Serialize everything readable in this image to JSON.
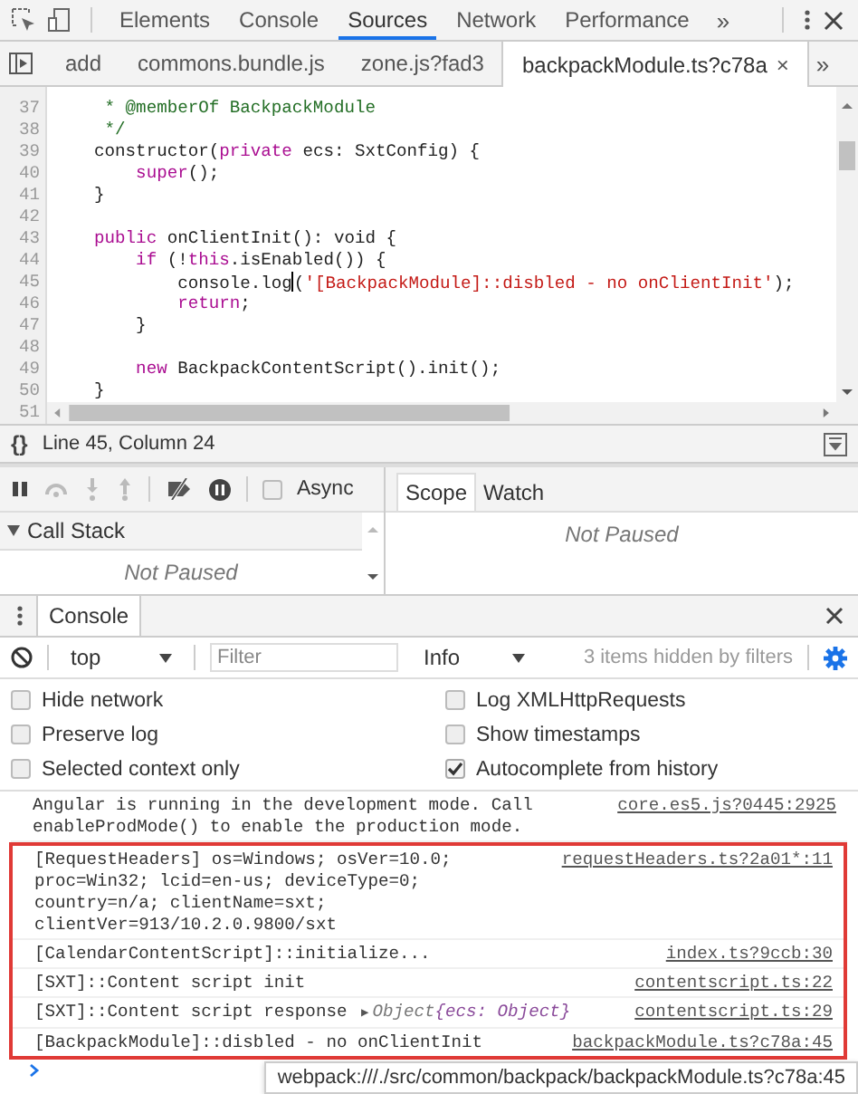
{
  "top_tabs": [
    {
      "label": "Elements",
      "selected": false
    },
    {
      "label": "Console",
      "selected": false
    },
    {
      "label": "Sources",
      "selected": true
    },
    {
      "label": "Network",
      "selected": false
    },
    {
      "label": "Performance",
      "selected": false
    }
  ],
  "top_more": "»",
  "file_tabs": [
    {
      "label": "add",
      "selected": false
    },
    {
      "label": "commons.bundle.js",
      "selected": false
    },
    {
      "label": "zone.js?fad3",
      "selected": false
    },
    {
      "label": "backpackModule.ts?c78a",
      "selected": true,
      "close": "×"
    }
  ],
  "file_more": "»",
  "editor": {
    "lines": [
      {
        "number": "37",
        "tokens": [
          {
            "kind": "comment",
            "text": "     * @memberOf BackpackModule"
          }
        ]
      },
      {
        "number": "38",
        "tokens": [
          {
            "kind": "comment",
            "text": "     */"
          }
        ]
      },
      {
        "number": "39",
        "tokens": [
          {
            "kind": "plain",
            "text": "    constructor("
          },
          {
            "kind": "keyword",
            "text": "private"
          },
          {
            "kind": "plain",
            "text": " ecs: SxtConfig) {"
          }
        ]
      },
      {
        "number": "40",
        "tokens": [
          {
            "kind": "keyword",
            "text": "        super"
          },
          {
            "kind": "plain",
            "text": "();"
          }
        ]
      },
      {
        "number": "41",
        "tokens": [
          {
            "kind": "plain",
            "text": "    }"
          }
        ]
      },
      {
        "number": "42"
      },
      {
        "number": "43",
        "tokens": [
          {
            "kind": "keyword",
            "text": "    public"
          },
          {
            "kind": "plain",
            "text": " onClientInit(): void {"
          }
        ]
      },
      {
        "number": "44",
        "tokens": [
          {
            "kind": "keyword",
            "text": "        if"
          },
          {
            "kind": "plain",
            "text": " (!"
          },
          {
            "kind": "keyword",
            "text": "this"
          },
          {
            "kind": "plain",
            "text": ".isEnabled()) {"
          }
        ]
      },
      {
        "number": "45",
        "tokens": [
          {
            "kind": "plain",
            "text": "            console.log"
          },
          {
            "kind": "cursor"
          },
          {
            "kind": "plain",
            "text": "("
          },
          {
            "kind": "string",
            "text": "'[BackpackModule]::disbled - no onClientInit'"
          },
          {
            "kind": "plain",
            "text": ");"
          }
        ]
      },
      {
        "number": "46",
        "tokens": [
          {
            "kind": "keyword",
            "text": "            return"
          },
          {
            "kind": "plain",
            "text": ";"
          }
        ]
      },
      {
        "number": "47",
        "tokens": [
          {
            "kind": "plain",
            "text": "        }"
          }
        ]
      },
      {
        "number": "48"
      },
      {
        "number": "49",
        "tokens": [
          {
            "kind": "keyword",
            "text": "        new"
          },
          {
            "kind": "plain",
            "text": " BackpackContentScript().init();"
          }
        ]
      },
      {
        "number": "50",
        "tokens": [
          {
            "kind": "plain",
            "text": "    }"
          }
        ]
      }
    ],
    "last_number": "51"
  },
  "status": {
    "format": "{}",
    "position": "Line 45, Column 24"
  },
  "debugger": {
    "async": {
      "label": "Async",
      "checked": false
    },
    "sidebar_tabs": [
      {
        "label": "Scope",
        "selected": true
      },
      {
        "label": "Watch",
        "selected": false
      }
    ],
    "call_stack": {
      "title": "Call Stack",
      "empty_text": "Not Paused"
    },
    "scope_text": "Not Paused"
  },
  "drawer_tabs": [
    {
      "label": "Console",
      "selected": true
    }
  ],
  "console_toolbar": {
    "context": "top",
    "filter_placeholder": "Filter",
    "level": "Info",
    "hidden_note": "3 items hidden by filters"
  },
  "settings": [
    {
      "label": "Hide network",
      "checked": false
    },
    {
      "label": "Log XMLHttpRequests",
      "checked": false
    },
    {
      "label": "Preserve log",
      "checked": false
    },
    {
      "label": "Show timestamps",
      "checked": false
    },
    {
      "label": "Selected context only",
      "checked": false
    },
    {
      "label": "Autocomplete from history",
      "checked": true
    }
  ],
  "messages": [
    {
      "text": "Angular is running in the development mode. Call enableProdMode() to enable the production mode.",
      "source": "core.es5.js?0445:2925",
      "highlighted": false
    },
    {
      "text": "[RequestHeaders] os=Windows; osVer=10.0; proc=Win32; lcid=en-us; deviceType=0; country=n/a; clientName=sxt; clientVer=913/10.2.0.9800/sxt",
      "source": "requestHeaders.ts?2a01*:11",
      "highlighted": true
    },
    {
      "text": "[CalendarContentScript]::initialize...",
      "source": "index.ts?9ccb:30",
      "highlighted": true
    },
    {
      "text": "[SXT]::Content script init",
      "source": "contentscript.ts:22",
      "highlighted": true
    },
    {
      "text": "[SXT]::Content script response ",
      "object": {
        "arrow": "▶",
        "label": "Object",
        "preview": "{ecs: Object}"
      },
      "source": "contentscript.ts:29",
      "highlighted": true
    },
    {
      "text": "[BackpackModule]::disbled - no onClientInit",
      "source": "backpackModule.ts?c78a:45",
      "highlighted": true
    }
  ],
  "tooltip": "webpack:///./src/common/backpack/backpackModule.ts?c78a:45"
}
